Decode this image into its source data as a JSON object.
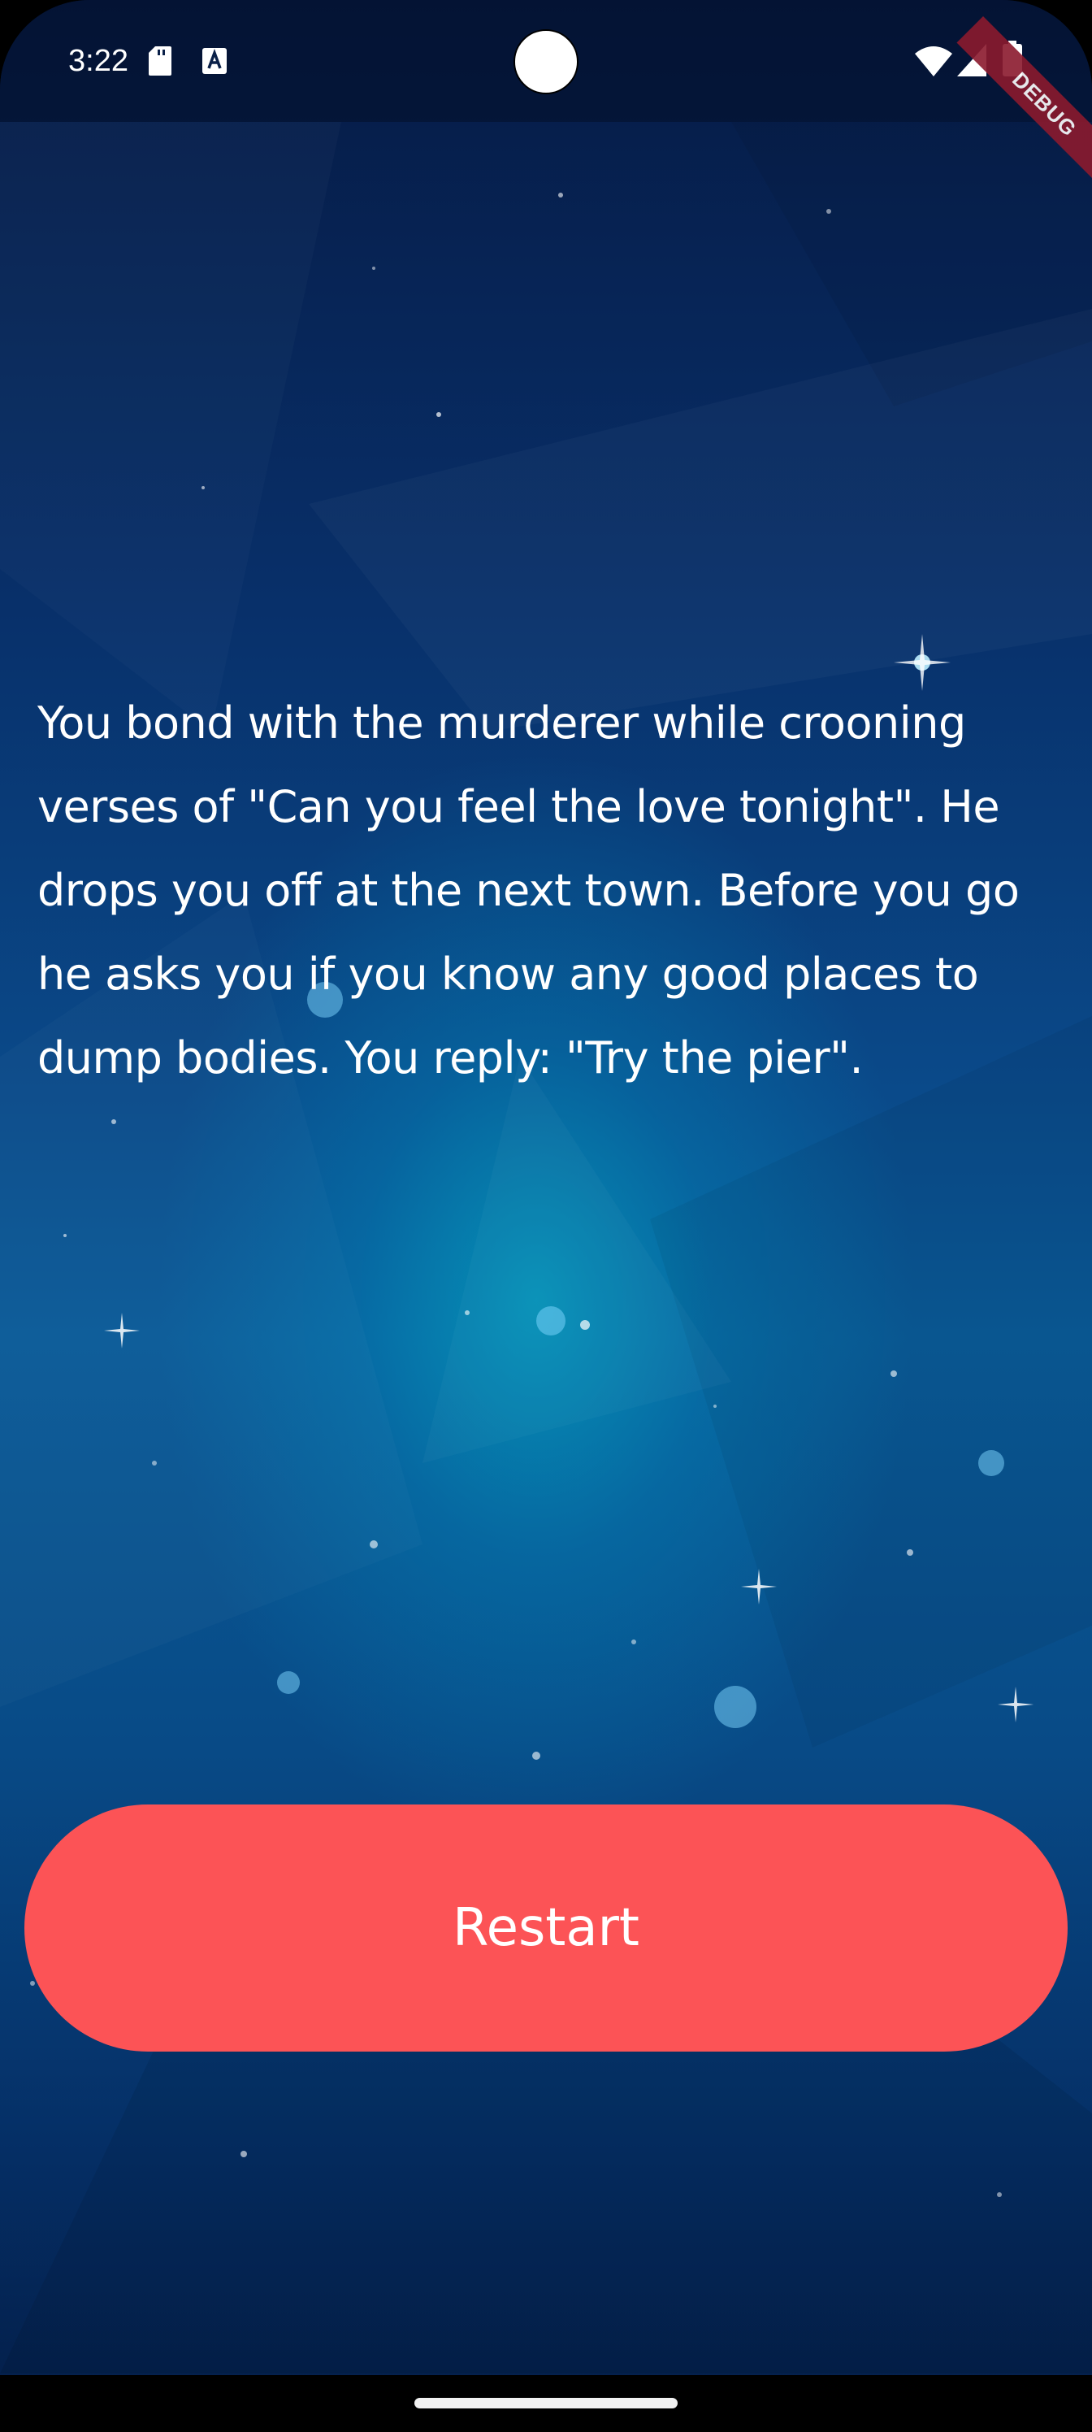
{
  "status_bar": {
    "time": "3:22",
    "sd_card_icon": "sd-card-icon",
    "text_input_icon": "a-icon",
    "wifi_icon": "wifi-icon",
    "signal_icon": "signal-icon",
    "battery_icon": "battery-icon"
  },
  "debug_banner": "DEBUG",
  "story": {
    "text": "You bond with the murderer while crooning verses of \"Can you feel the love tonight\". He drops you off at the next town. Before you go he asks you if you know any good places to dump bodies. You reply: \"Try the pier\"."
  },
  "actions": {
    "restart_label": "Restart"
  },
  "colors": {
    "button": "#fc5356",
    "text": "#ffffff",
    "background_top": "#061a44",
    "background_glow": "#00bed2"
  }
}
